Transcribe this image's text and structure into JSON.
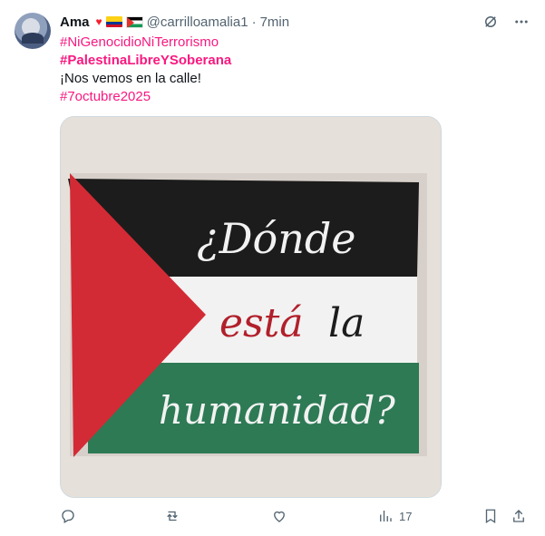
{
  "post": {
    "author_name": "Ama",
    "handle": "@carrilloamalia1",
    "separator": "·",
    "time": "7min",
    "hashtags": {
      "first": "#NiGenocidioNiTerrorismo",
      "second": "#PalestinaLibreYSoberana",
      "third": "#7octubre2025"
    },
    "text": "¡Nos vemos en la calle!",
    "image": {
      "line1": "¿Dónde",
      "line2_a": "está",
      "line2_b": "la",
      "line3": "humanidad?"
    }
  },
  "actions": {
    "views_count": "17"
  },
  "icons": {
    "top": [
      "grok-icon",
      "more-icon"
    ],
    "actions": [
      "reply-icon",
      "retweet-icon",
      "like-icon",
      "views-icon",
      "bookmark-icon",
      "share-icon"
    ]
  },
  "colors": {
    "hashtag": "#f91880",
    "muted": "#536471",
    "flag_black": "#1c1c1c",
    "flag_white": "#f2f2f2",
    "flag_green": "#2d7a55",
    "flag_red": "#d32b35"
  }
}
